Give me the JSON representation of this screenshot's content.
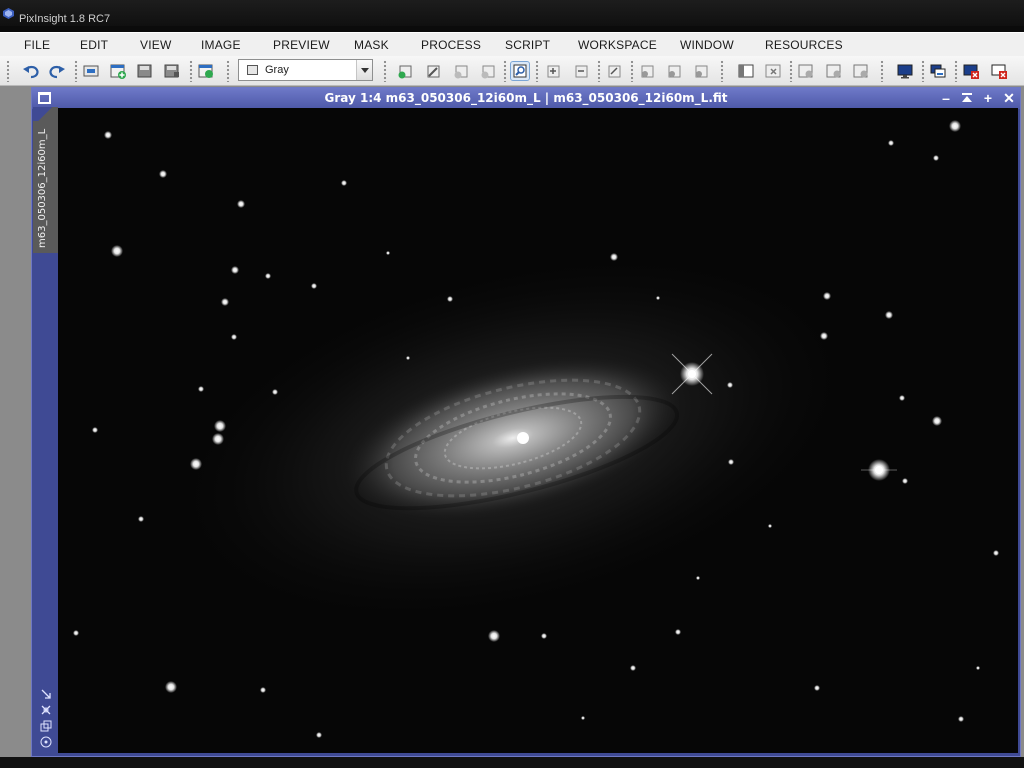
{
  "app": {
    "title": "PixInsight 1.8 RC7"
  },
  "menu": [
    {
      "id": "file",
      "label": "FILE"
    },
    {
      "id": "edit",
      "label": "EDIT"
    },
    {
      "id": "view",
      "label": "VIEW"
    },
    {
      "id": "image",
      "label": "IMAGE"
    },
    {
      "id": "preview",
      "label": "PREVIEW"
    },
    {
      "id": "mask",
      "label": "MASK"
    },
    {
      "id": "process",
      "label": "PROCESS"
    },
    {
      "id": "script",
      "label": "SCRIPT"
    },
    {
      "id": "workspace",
      "label": "WORKSPACE"
    },
    {
      "id": "window",
      "label": "WINDOW"
    },
    {
      "id": "resources",
      "label": "RESOURCES"
    }
  ],
  "toolbar": {
    "color_space_selected": "Gray",
    "buttons": [
      {
        "name": "undo-icon"
      },
      {
        "name": "redo-icon"
      },
      {
        "name": "open-file-icon"
      },
      {
        "name": "new-image-icon"
      },
      {
        "name": "save-icon"
      },
      {
        "name": "save-as-icon"
      },
      {
        "name": "new-view-icon"
      },
      {
        "name": "new-preview-icon"
      },
      {
        "name": "edit-preview-icon"
      },
      {
        "name": "preview-plus-icon"
      },
      {
        "name": "preview-minus-icon"
      },
      {
        "name": "zoom-mode-icon"
      },
      {
        "name": "zoom-in-icon"
      },
      {
        "name": "zoom-out-icon"
      },
      {
        "name": "zoom-fit-icon"
      },
      {
        "name": "mask-enable-icon"
      },
      {
        "name": "mask-show-icon"
      },
      {
        "name": "mask-invert-icon"
      },
      {
        "name": "layout-icon"
      },
      {
        "name": "close-all-icon"
      },
      {
        "name": "stf-icon"
      },
      {
        "name": "stf-reset-icon"
      },
      {
        "name": "stf-link-icon"
      },
      {
        "name": "monitor-icon"
      },
      {
        "name": "tile-windows-icon"
      },
      {
        "name": "close-red-icon"
      },
      {
        "name": "close-all-red-icon"
      }
    ]
  },
  "image_window": {
    "title": "Gray 1:4 m63_050306_12i60m_L | m63_050306_12i60m_L.fit",
    "tab_label": "m63_050306_12i60m_L",
    "controls": [
      "minimize",
      "shade",
      "maximize",
      "close"
    ],
    "side_controls": [
      "zoom-arrow-icon",
      "transform-icon",
      "shrink-icon",
      "target-icon"
    ]
  },
  "colors": {
    "window_frame": "#3f4a94",
    "window_title": "#5a65b8",
    "workspace": "#8b8b8b"
  }
}
